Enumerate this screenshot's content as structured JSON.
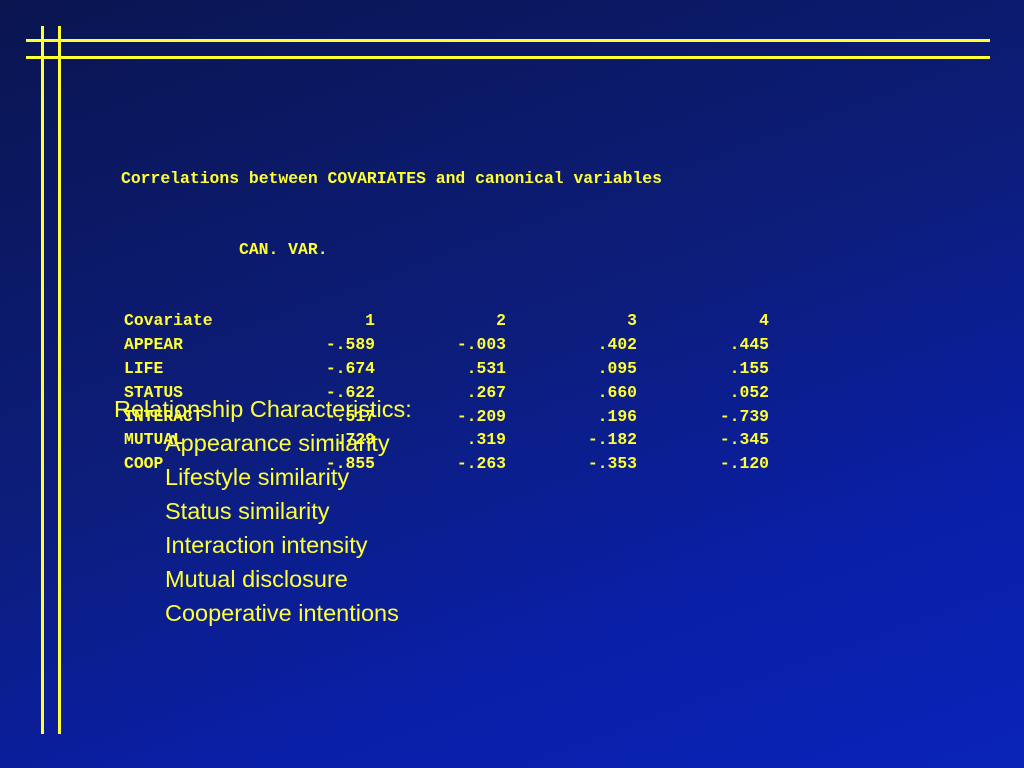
{
  "output": {
    "title": "Correlations between COVARIATES and canonical variables",
    "subheading": "CAN. VAR.",
    "columns": [
      "Covariate",
      "1",
      "2",
      "3",
      "4"
    ],
    "rows": [
      {
        "name": "APPEAR",
        "values": [
          "-.589",
          "-.003",
          ".402",
          ".445"
        ]
      },
      {
        "name": "LIFE",
        "values": [
          "-.674",
          ".531",
          ".095",
          ".155"
        ]
      },
      {
        "name": "STATUS",
        "values": [
          "-.622",
          ".267",
          ".660",
          ".052"
        ]
      },
      {
        "name": "INTERACT",
        "values": [
          "-.517",
          "-.209",
          ".196",
          "-.739"
        ]
      },
      {
        "name": "MUTUAL",
        "values": [
          "-.729",
          ".319",
          "-.182",
          "-.345"
        ]
      },
      {
        "name": "COOP",
        "values": [
          "-.855",
          "-.263",
          "-.353",
          "-.120"
        ]
      }
    ]
  },
  "characteristics": {
    "heading": "Relationship Characteristics:",
    "items": [
      "Appearance similarity",
      "Lifestyle similarity",
      "Status similarity",
      "Interaction intensity",
      "Mutual disclosure",
      "Cooperative intentions"
    ]
  },
  "colors": {
    "text": "#ffff33",
    "background": "#0c1d7a",
    "accent_lines": "#ffff33"
  }
}
